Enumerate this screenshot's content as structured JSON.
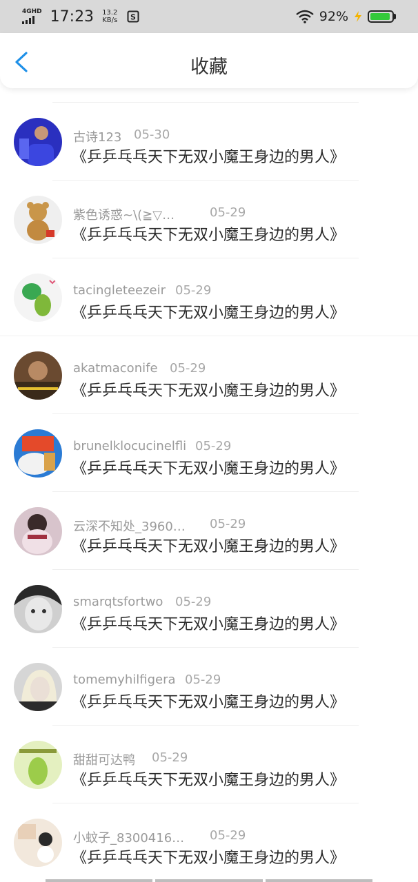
{
  "status_bar": {
    "network_label": "4GHD",
    "time": "17:23",
    "speed_value": "13.2",
    "speed_unit": "KB/s",
    "battery_percent": "92%",
    "battery_level": 0.92,
    "battery_color": "#34c93a"
  },
  "header": {
    "title": "收藏",
    "back_icon": "chevron-left-icon",
    "accent_color": "#1e90e8"
  },
  "favorites": [
    {
      "user": "古诗123",
      "date": "05-30",
      "title": "《乒乒乓乓天下无双小魔王身边的男人》"
    },
    {
      "user": "紫色诱惑~\\(≧▽…",
      "date": "05-29",
      "title": "《乒乒乓乓天下无双小魔王身边的男人》"
    },
    {
      "user": "tacingleteezeir",
      "date": "05-29",
      "title": "《乒乒乓乓天下无双小魔王身边的男人》"
    },
    {
      "user": "akatmaconife",
      "date": "05-29",
      "title": "《乒乒乓乓天下无双小魔王身边的男人》"
    },
    {
      "user": "brunelklocucinelfli",
      "date": "05-29",
      "title": "《乒乒乓乓天下无双小魔王身边的男人》"
    },
    {
      "user": "云深不知处_3960…",
      "date": "05-29",
      "title": "《乒乒乓乓天下无双小魔王身边的男人》"
    },
    {
      "user": "smarqtsfortwo",
      "date": "05-29",
      "title": "《乒乒乓乓天下无双小魔王身边的男人》"
    },
    {
      "user": "tomemyhilfigera",
      "date": "05-29",
      "title": "《乒乒乓乓天下无双小魔王身边的男人》"
    },
    {
      "user": "甜甜可达鸭",
      "date": "05-29",
      "title": "《乒乒乓乓天下无双小魔王身边的男人》"
    },
    {
      "user": "小蚊子_8300416…",
      "date": "05-29",
      "title": "《乒乒乓乓天下无双小魔王身边的男人》"
    }
  ]
}
